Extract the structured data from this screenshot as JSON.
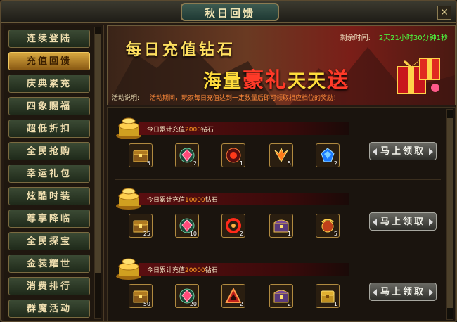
{
  "window": {
    "title": "秋日回馈",
    "close_icon": "close-icon"
  },
  "sidebar": {
    "items": [
      {
        "label": "连续登陆",
        "active": false
      },
      {
        "label": "充值回馈",
        "active": true
      },
      {
        "label": "庆典累充",
        "active": false
      },
      {
        "label": "四象赐福",
        "active": false
      },
      {
        "label": "超低折扣",
        "active": false
      },
      {
        "label": "全民抢购",
        "active": false
      },
      {
        "label": "幸运礼包",
        "active": false
      },
      {
        "label": "炫酷时装",
        "active": false
      },
      {
        "label": "尊享降临",
        "active": false
      },
      {
        "label": "全民探宝",
        "active": false
      },
      {
        "label": "金装耀世",
        "active": false
      },
      {
        "label": "消费排行",
        "active": false
      },
      {
        "label": "群魔活动",
        "active": false
      }
    ]
  },
  "banner": {
    "title": "每日充值钻石",
    "subtitle_a": "海量",
    "subtitle_b": "豪礼",
    "subtitle_c": "天天",
    "subtitle_d": "送",
    "countdown_label": "剩余时间:",
    "countdown_value": "2天21小时30分钟1秒",
    "desc_label": "活动说明:",
    "desc_text": "活动期间，玩家每日充值达到一定数量后即可领取相应档位的奖励！"
  },
  "tiers": [
    {
      "prefix": "今日累计充值",
      "amount": "2000",
      "suffix": "钻石",
      "items": [
        {
          "icon": "chest-icon",
          "count": "5"
        },
        {
          "icon": "pink-gem-icon",
          "count": "2"
        },
        {
          "icon": "red-orb-icon",
          "count": "1"
        },
        {
          "icon": "wing-icon",
          "count": "5"
        },
        {
          "icon": "blue-gem-icon",
          "count": "2"
        }
      ],
      "button": "马上领取"
    },
    {
      "prefix": "今日累计充值",
      "amount": "10000",
      "suffix": "钻石",
      "items": [
        {
          "icon": "chest-icon",
          "count": "25"
        },
        {
          "icon": "pink-gem-icon",
          "count": "10"
        },
        {
          "icon": "red-ring-icon",
          "count": "2"
        },
        {
          "icon": "treasure-box-icon",
          "count": "1"
        },
        {
          "icon": "dragon-orb-icon",
          "count": "5"
        }
      ],
      "button": "马上领取"
    },
    {
      "prefix": "今日累计充值",
      "amount": "20000",
      "suffix": "钻石",
      "items": [
        {
          "icon": "chest-icon",
          "count": "50"
        },
        {
          "icon": "pink-gem-icon",
          "count": "20"
        },
        {
          "icon": "triangle-rune-icon",
          "count": "2"
        },
        {
          "icon": "treasure-box-icon",
          "count": "2"
        },
        {
          "icon": "gold-chest-icon",
          "count": "1"
        }
      ],
      "button": "马上领取"
    }
  ]
}
